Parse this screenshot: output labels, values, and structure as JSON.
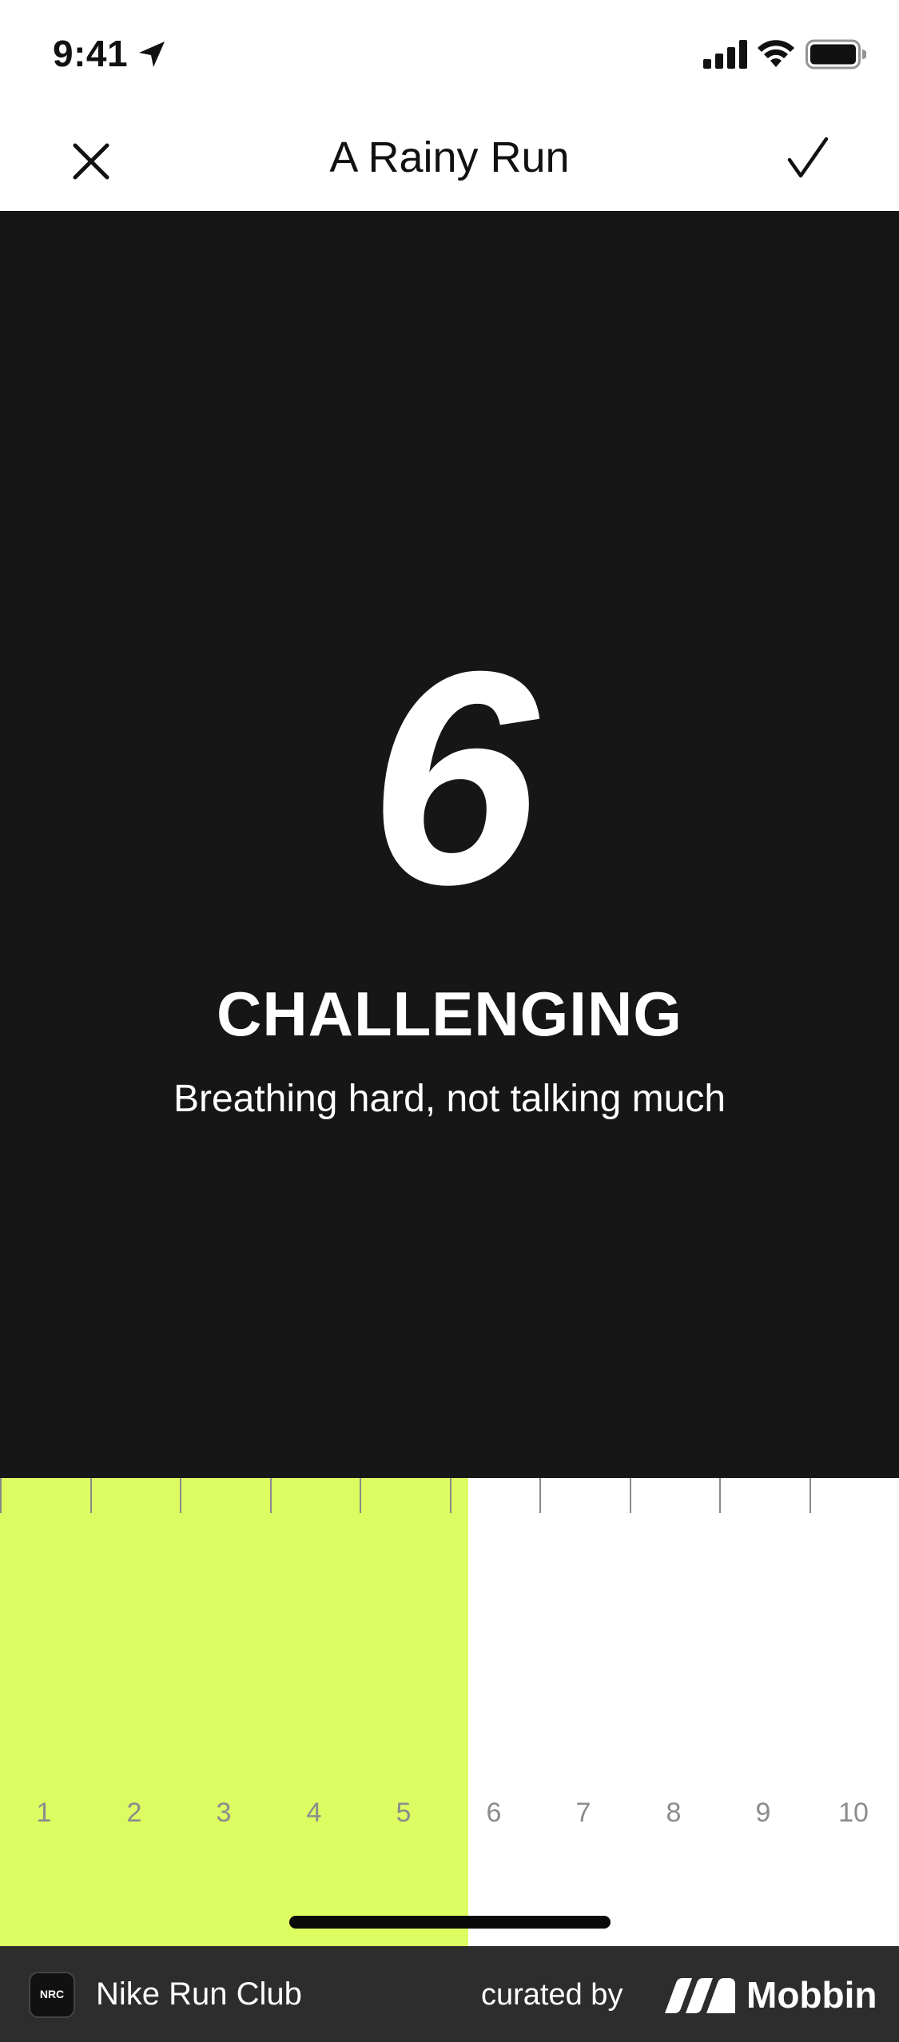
{
  "status_bar": {
    "time": "9:41",
    "icons": [
      "location-arrow-icon",
      "cellular-signal-icon",
      "wifi-icon",
      "battery-icon"
    ]
  },
  "nav": {
    "title": "A Rainy Run",
    "left_icon": "close-icon",
    "right_icon": "checkmark-icon"
  },
  "effort": {
    "value": "6",
    "level": "CHALLENGING",
    "description": "Breathing hard, not talking much"
  },
  "slider": {
    "selected": 6,
    "min": 1,
    "max": 10,
    "labels": [
      "1",
      "2",
      "3",
      "4",
      "5",
      "6",
      "7",
      "8",
      "9",
      "10"
    ],
    "fill_color": "#dcfc62"
  },
  "footer": {
    "app_icon_text": "NRC",
    "app_name": "Nike Run Club",
    "curated_by": "curated by",
    "brand": "Mobbin"
  },
  "colors": {
    "panel_background": "#161616",
    "accent": "#dcfc62",
    "footer_background": "#2d2d2d"
  }
}
